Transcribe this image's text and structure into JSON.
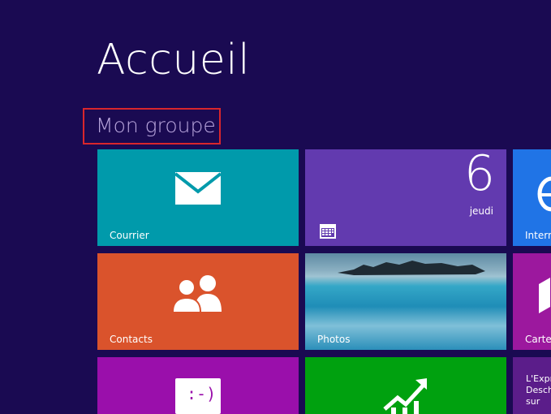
{
  "page": {
    "title": "Accueil",
    "group_name": "Mon groupe"
  },
  "tiles": {
    "mail": {
      "label": "Courrier",
      "icon": "mail-icon",
      "color": "#009aab"
    },
    "calendar": {
      "day_number": "6",
      "day_name": "jeudi",
      "icon": "calendar-icon",
      "color": "#623aaf"
    },
    "ie": {
      "label": "Intern",
      "icon": "internet-explorer-icon",
      "color": "#2074e6"
    },
    "contacts": {
      "label": "Contacts",
      "icon": "people-icon",
      "color": "#da532c"
    },
    "photos": {
      "label": "Photos",
      "color": "#2a7ca8"
    },
    "maps": {
      "label": "Cartes",
      "icon": "map-icon",
      "color": "#9c189e"
    },
    "messaging": {
      "icon": "smiley-icon",
      "text": ":-)",
      "color": "#9a0fab"
    },
    "finance": {
      "icon": "chart-up-icon",
      "color": "#00a10f"
    },
    "news": {
      "line1": "L'Expr",
      "line2": "Desch",
      "line3": "sur",
      "color": "#5b1d8a"
    }
  }
}
